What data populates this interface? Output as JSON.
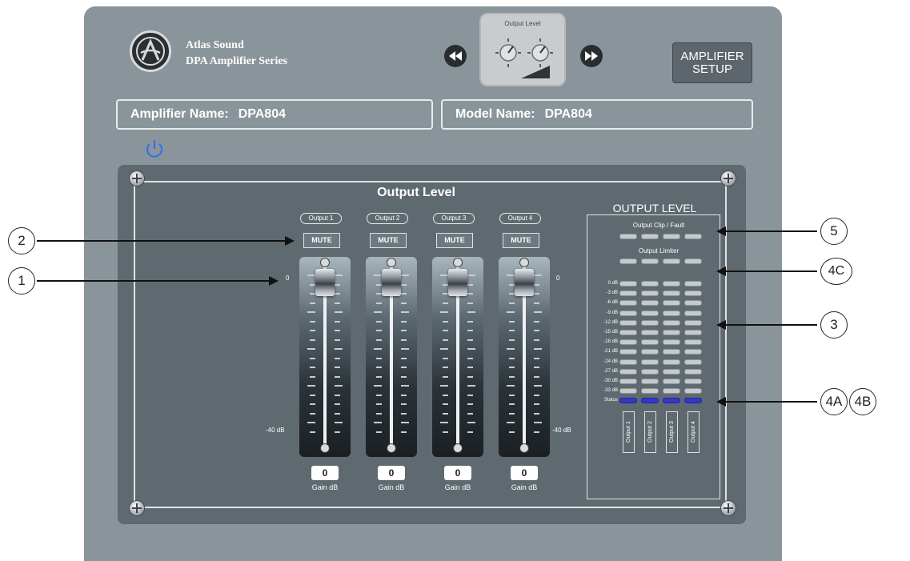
{
  "header": {
    "brand_line1": "Atlas Sound",
    "brand_line2": "DPA Amplifier Series",
    "thumbnail_title": "Output Level",
    "setup_button": [
      "AMPLIFIER",
      "SETUP"
    ],
    "prev_icon": "rewind-icon",
    "next_icon": "fast-forward-icon",
    "power_icon": "power-icon"
  },
  "info": {
    "amp_name_label": "Amplifier Name:",
    "amp_name_value": "DPA804",
    "model_name_label": "Model Name:",
    "model_name_value": "DPA804"
  },
  "panel": {
    "title": "Output Level",
    "scale_top": "0",
    "scale_bottom": "-40 dB",
    "mute_label": "MUTE",
    "gain_label": "Gain dB",
    "channels": [
      {
        "name": "Output 1",
        "gain": "0"
      },
      {
        "name": "Output 2",
        "gain": "0"
      },
      {
        "name": "Output 3",
        "gain": "0"
      },
      {
        "name": "Output 4",
        "gain": "0"
      }
    ]
  },
  "meter": {
    "title": "OUTPUT LEVEL",
    "clip_label": "Output Clip / Fault",
    "limiter_label": "Output Limiter",
    "db_labels": [
      "0 dB",
      "-3 dB",
      "-6 dB",
      "-9 dB",
      "-12 dB",
      "-15 dB",
      "-18 dB",
      "-21 dB",
      "-24 dB",
      "-27 dB",
      "-30 dB",
      "-33 dB",
      "Status"
    ],
    "channel_labels": [
      "Output 1",
      "Output 2",
      "Output 3",
      "Output 4"
    ]
  },
  "callouts": [
    "2",
    "1",
    "5",
    "4C",
    "3",
    "4A",
    "4B"
  ],
  "colors": {
    "status_segment": "#3636c8",
    "panel": "#5f6970",
    "frame": "#8a949b"
  }
}
